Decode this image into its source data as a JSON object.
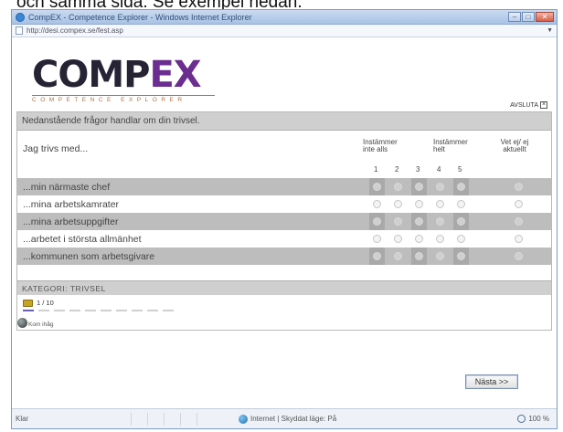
{
  "caption": "och samma sida. Se exempel nedan.",
  "window": {
    "title": "CompEX - Competence Explorer - Windows Internet Explorer",
    "url": "http://desi.compex.se/fest.asp",
    "buttons": {
      "minimize": "–",
      "maximize": "□",
      "close": "✕"
    }
  },
  "logo": {
    "main": "COMP",
    "ex": "EX",
    "sub": "COMPETENCE EXPLORER"
  },
  "avsluta": "AVSLUTA",
  "intro": "Nedanstående frågor handlar om din trivsel.",
  "question_stem": "Jag trivs med...",
  "scale": {
    "low": "Instämmer inte alls",
    "high": "Instämmer helt",
    "unknown": "Vet ej/ ej aktuellt",
    "numbers": [
      "1",
      "2",
      "3",
      "4",
      "5"
    ]
  },
  "rows": [
    "...min närmaste chef",
    "...mina arbetskamrater",
    "...mina arbetsuppgifter",
    "...arbetet i största allmänhet",
    "...kommunen som arbetsgivare"
  ],
  "category": "KATEGORI: TRIVSEL",
  "progress": "1 / 10",
  "progress_position": 1,
  "progress_total": 10,
  "status_mini": "Kom ihåg",
  "next_button": "Nästa >>",
  "statusbar": {
    "left": "Klar",
    "zone": "Internet | Skyddat läge: På",
    "zoom": "100 %"
  },
  "colors": {
    "logo_dark": "#262335",
    "logo_accent": "#6b2d8f",
    "row_shade": "#bdbdbd",
    "progress_active": "#6b5fb4"
  }
}
